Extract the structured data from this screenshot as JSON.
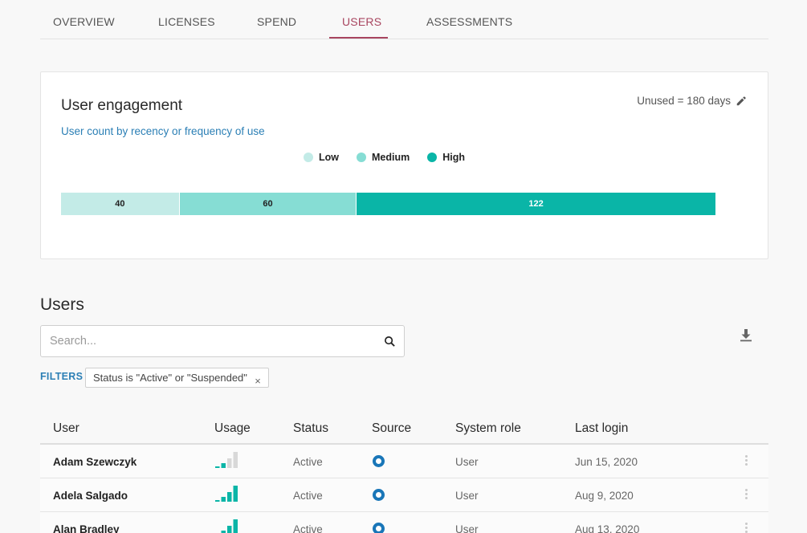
{
  "tabs": [
    {
      "label": "OVERVIEW",
      "active": false
    },
    {
      "label": "LICENSES",
      "active": false
    },
    {
      "label": "SPEND",
      "active": false
    },
    {
      "label": "USERS",
      "active": true
    },
    {
      "label": "ASSESSMENTS",
      "active": false
    }
  ],
  "engagement": {
    "title": "User engagement",
    "subtitle": "User count by recency or frequency of use",
    "unused_label": "Unused = 180 days",
    "edit_icon": "pencil-icon"
  },
  "chart_data": {
    "type": "bar",
    "orientation": "horizontal-stacked",
    "categories": [
      "Low",
      "Medium",
      "High"
    ],
    "values": [
      40,
      60,
      122
    ],
    "colors": [
      "#c3ebe7",
      "#86ddd4",
      "#0ab5a7"
    ],
    "legend": "top"
  },
  "users_section": {
    "title": "Users",
    "search_placeholder": "Search...",
    "search_icon": "search-icon",
    "download_icon": "download-icon",
    "filters_label": "FILTERS",
    "filter_chip": "Status is \"Active\" or \"Suspended\"",
    "chip_close": "×"
  },
  "table": {
    "columns": [
      "User",
      "Usage",
      "Status",
      "Source",
      "System role",
      "Last login"
    ],
    "rows": [
      {
        "user": "Adam Szewczyk",
        "usage_level": 2,
        "status": "Active",
        "source_icon": "source-ring-icon",
        "role": "User",
        "last_login": "Jun 15, 2020"
      },
      {
        "user": "Adela Salgado",
        "usage_level": 4,
        "status": "Active",
        "source_icon": "source-ring-icon",
        "role": "User",
        "last_login": "Aug 9, 2020"
      },
      {
        "user": "Alan Bradley",
        "usage_level": 4,
        "status": "Active",
        "source_icon": "source-ring-icon",
        "role": "User",
        "last_login": "Aug 13, 2020"
      }
    ]
  },
  "colors": {
    "accent": "#a8455f",
    "link": "#2b7fb5",
    "usage_on": "#0ab5a7",
    "usage_off": "#d8d8d8",
    "source": "#1976b8"
  }
}
